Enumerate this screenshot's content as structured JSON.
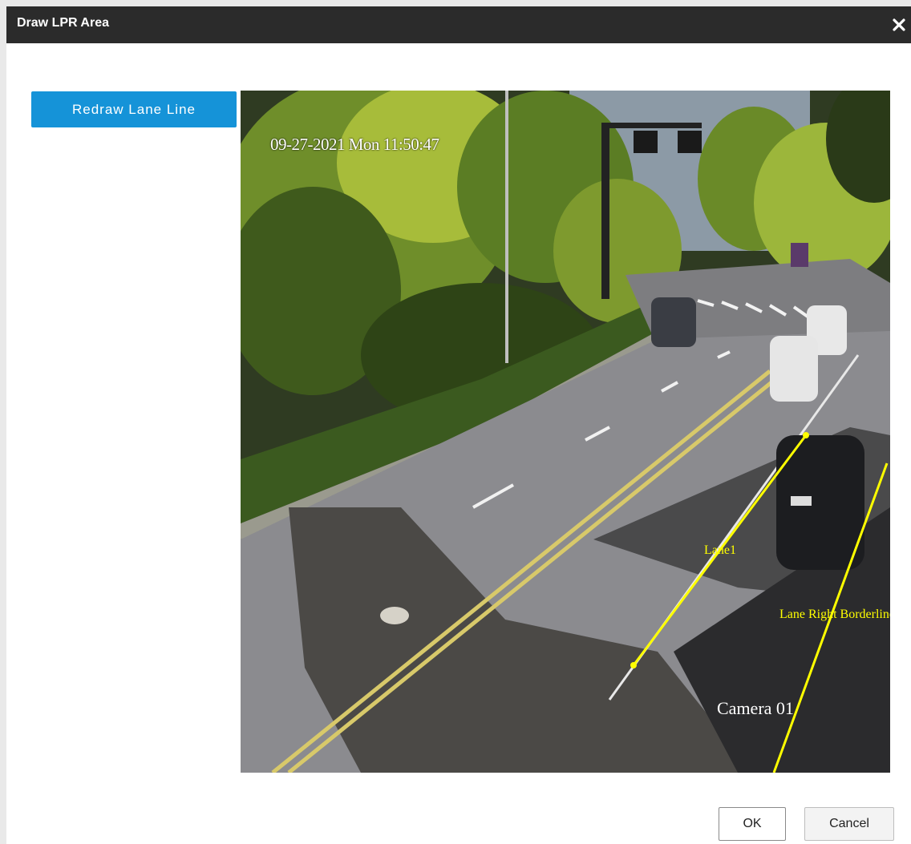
{
  "dialog": {
    "title": "Draw LPR Area",
    "close_icon": "close-icon"
  },
  "toolbar": {
    "redraw_label": "Redraw Lane Line"
  },
  "video": {
    "timestamp": "09-27-2021 Mon 11:50:47",
    "camera_name": "Camera 01",
    "lane_label": "Lane1",
    "border_label": "Lane Right Borderline",
    "line_color": "#ffff00"
  },
  "footer": {
    "ok_label": "OK",
    "cancel_label": "Cancel"
  }
}
